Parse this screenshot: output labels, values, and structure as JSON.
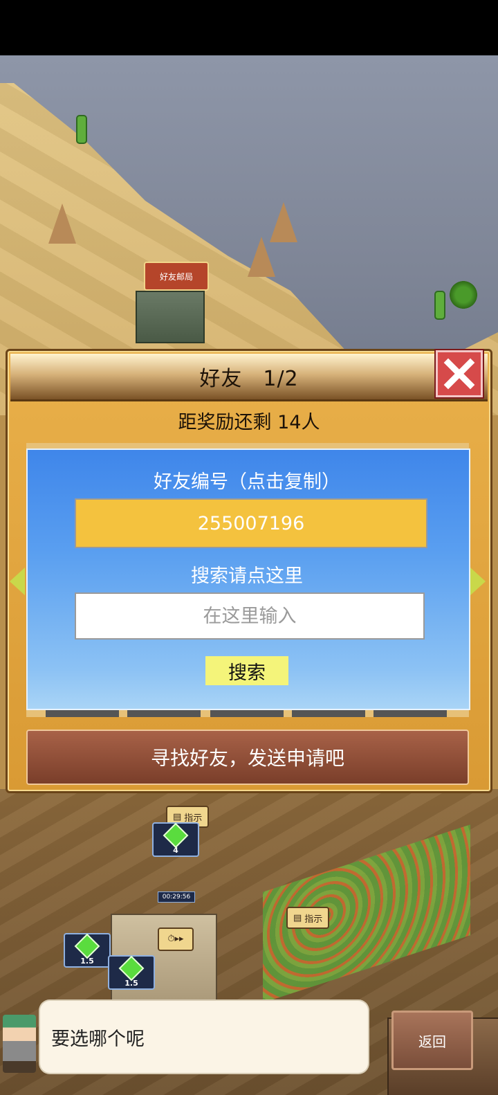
{
  "world": {
    "post_office_label": "好友邮局",
    "hint_label": "指示",
    "timer": "00:29:56",
    "gem_badges": [
      "4",
      "1.5",
      "1.5"
    ]
  },
  "dialog": {
    "title": "好友",
    "page": "1/2",
    "reward_text": "距奖励还剩 14人",
    "friend_id_label": "好友编号（点击复制）",
    "friend_id": "255007196",
    "search_label": "搜索请点这里",
    "search_placeholder": "在这里输入",
    "search_button": "搜索",
    "find_friends": "寻找好友，发送申请吧"
  },
  "bottom": {
    "speech": "要选哪个呢",
    "back_button": "返回"
  },
  "colors": {
    "dialog_bg": "#e9b04a",
    "panel_blue": "#3f86ea",
    "id_box": "#f4c23e",
    "search_button": "#f4f47a",
    "close_red": "#d64a4a"
  }
}
